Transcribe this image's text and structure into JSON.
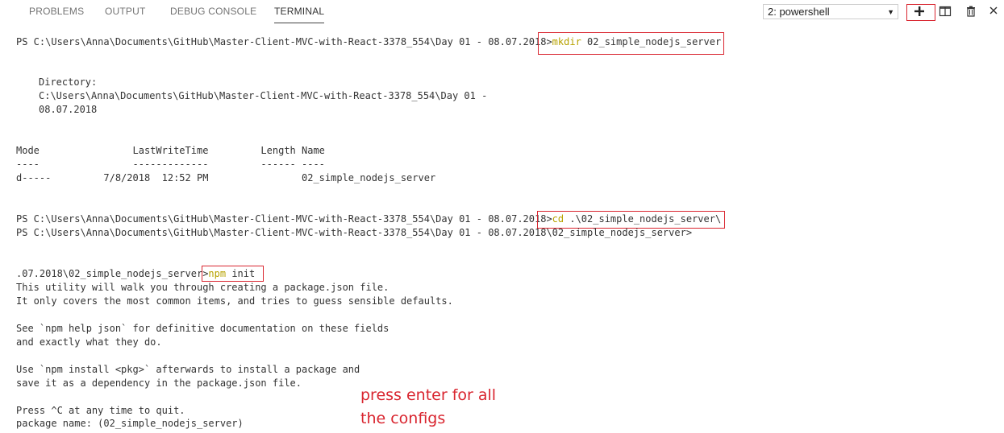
{
  "tabs": [
    {
      "label": "PROBLEMS"
    },
    {
      "label": "OUTPUT"
    },
    {
      "label": "DEBUG CONSOLE"
    },
    {
      "label": "TERMINAL",
      "active": true
    }
  ],
  "toolbar": {
    "terminal_select": "2: powershell",
    "new_terminal_icon": "plus-icon",
    "split_icon": "split-terminal-icon",
    "kill_icon": "trash-icon",
    "close_icon": "close-icon"
  },
  "terminal": {
    "l1_prompt": "PS C:\\Users\\Anna\\Documents\\GitHub\\Master-Client-MVC-with-React-3378_554\\Day 01 - 08.07.2018>",
    "l1_cmd": "mkdir",
    "l1_arg": " 02_simple_nodejs_server",
    "dir_label": "Directory:",
    "dir_path1": "C:\\Users\\Anna\\Documents\\GitHub\\Master-Client-MVC-with-React-3378_554\\Day 01 -",
    "dir_path2": "08.07.2018",
    "header": "Mode                LastWriteTime         Length Name",
    "underline": "----                -------------         ------ ----",
    "row": "d-----         7/8/2018  12:52 PM                02_simple_nodejs_server",
    "l2_prompt": "PS C:\\Users\\Anna\\Documents\\GitHub\\Master-Client-MVC-with-React-3378_554\\Day 01 - 08.07.2018>",
    "l2_cmd": "cd",
    "l2_arg": " .\\02_simple_nodejs_server\\",
    "l3_prompt": "PS C:\\Users\\Anna\\Documents\\GitHub\\Master-Client-MVC-with-React-3378_554\\Day 01 - 08.07.2018\\02_simple_nodejs_server>",
    "l4_prompt": ".07.2018\\02_simple_nodejs_server>",
    "l4_cmd": "npm",
    "l4_arg": " init",
    "out1": "This utility will walk you through creating a package.json file.",
    "out2": "It only covers the most common items, and tries to guess sensible defaults.",
    "out3": "See `npm help json` for definitive documentation on these fields",
    "out4": "and exactly what they do.",
    "out5": "Use `npm install <pkg>` afterwards to install a package and",
    "out6": "save it as a dependency in the package.json file.",
    "out7": "Press ^C at any time to quit.",
    "out8": "package name: (02_simple_nodejs_server)"
  },
  "annotation": {
    "line1": "press enter for all",
    "line2": "the configs"
  },
  "colors": {
    "highlight": "#d9252f",
    "command": "#b7a200"
  }
}
